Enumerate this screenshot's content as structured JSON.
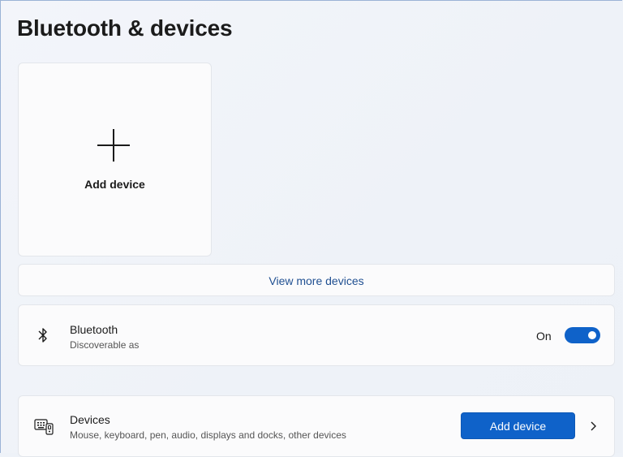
{
  "page": {
    "title": "Bluetooth & devices"
  },
  "add_tile": {
    "icon": "plus-icon",
    "label": "Add device"
  },
  "view_more": {
    "label": "View more devices"
  },
  "bluetooth": {
    "icon": "bluetooth-icon",
    "title": "Bluetooth",
    "subtitle": "Discoverable as",
    "state_label": "On",
    "enabled": true,
    "accent": "#0f62c9"
  },
  "devices": {
    "icon": "keyboard-device-icon",
    "title": "Devices",
    "subtitle": "Mouse, keyboard, pen, audio, displays and docks, other devices",
    "button_label": "Add device",
    "chevron": "chevron-right-icon"
  }
}
